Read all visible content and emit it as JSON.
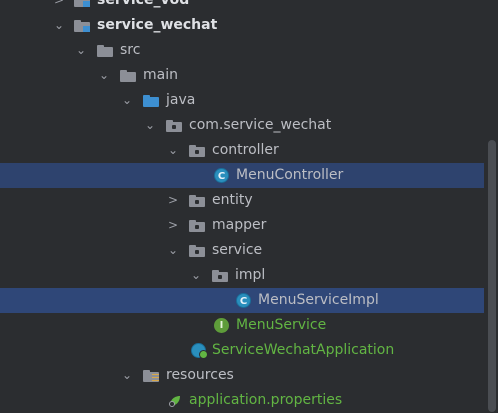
{
  "tree": {
    "rows": [
      {
        "label": "service_vod"
      },
      {
        "label": "service_wechat"
      },
      {
        "label": "src"
      },
      {
        "label": "main"
      },
      {
        "label": "java"
      },
      {
        "label": "com.service_wechat"
      },
      {
        "label": "controller"
      },
      {
        "label": "MenuController"
      },
      {
        "label": "entity"
      },
      {
        "label": "mapper"
      },
      {
        "label": "service"
      },
      {
        "label": "impl"
      },
      {
        "label": "MenuServiceImpl"
      },
      {
        "label": "MenuService"
      },
      {
        "label": "ServiceWechatApplication"
      },
      {
        "label": "resources"
      },
      {
        "label": "application.properties"
      }
    ]
  },
  "icons": {
    "class_glyph": "C",
    "interface_glyph": "I",
    "expanded_arrow": "⌄",
    "collapsed_arrow": "›"
  },
  "colors": {
    "background": "#2b2d30",
    "selection": "#2e436e",
    "text": "#bcbec4",
    "green_text": "#62b543",
    "folder": "#8c8f97",
    "source_folder": "#3d8fd1"
  }
}
